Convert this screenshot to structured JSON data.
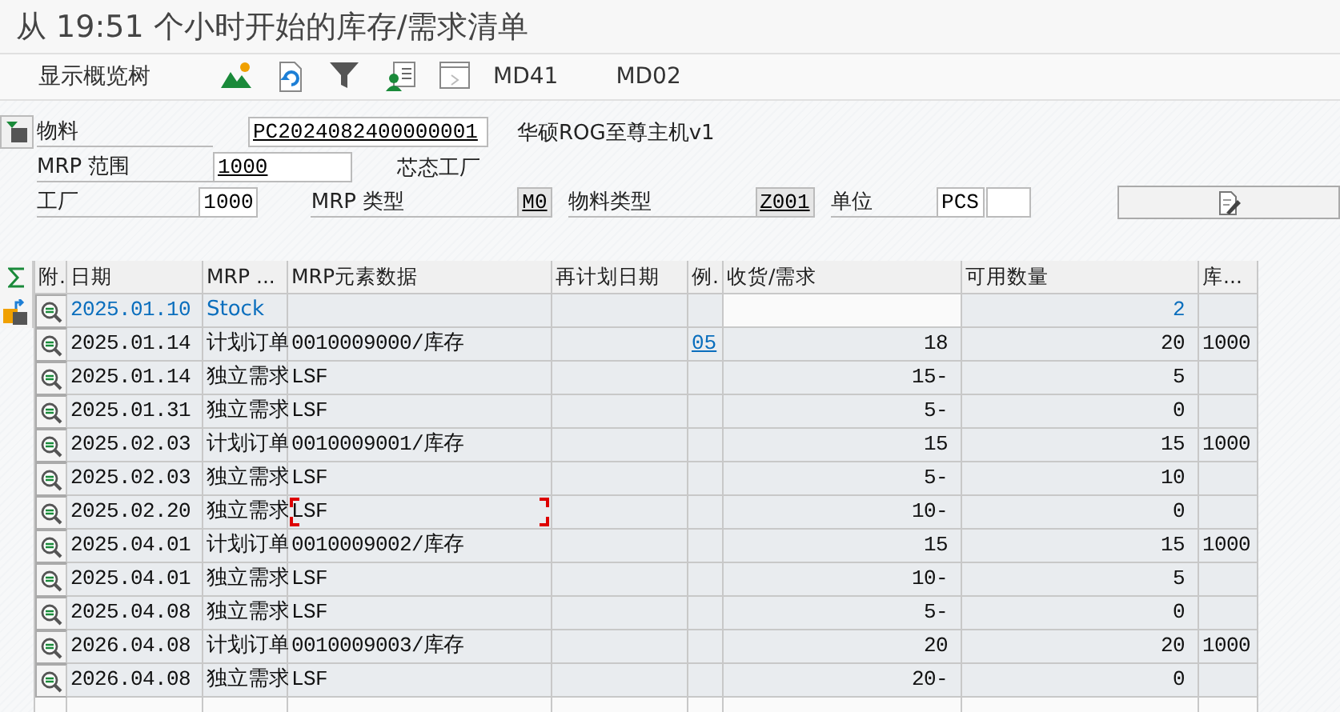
{
  "window": {
    "title": "从 19:51 个小时开始的库存/需求清单"
  },
  "toolbar": {
    "items": [
      {
        "kind": "text",
        "label": "显示概览树"
      },
      {
        "kind": "icon"
      },
      {
        "kind": "icon"
      },
      {
        "kind": "icon"
      },
      {
        "kind": "icon"
      },
      {
        "kind": "icon"
      },
      {
        "kind": "text",
        "label": "MD41"
      },
      {
        "kind": "text",
        "label": "MD02"
      }
    ]
  },
  "header": {
    "material_label": "物料",
    "material_value": "PC2024082400000001",
    "material_desc": "华硕ROG至尊主机v1",
    "mrp_area_label": "MRP 范围",
    "mrp_area_value": "1000",
    "mrp_area_desc": "芯态工厂",
    "plant_label": "工厂",
    "plant_value": "1000",
    "mrp_type_label": "MRP 类型",
    "mrp_type_value": "M0",
    "material_type_label": "物料类型",
    "material_type_value": "Z001",
    "unit_label": "单位",
    "unit_value": "PCS"
  },
  "table": {
    "columns": [
      "附.",
      "日期",
      "MRP ...",
      "MRP元素数据",
      "再计划日期",
      "例.",
      "收货/需求",
      "可用数量",
      "库..."
    ],
    "rows": [
      {
        "kind": "stock",
        "focused": false,
        "date": "2025.01.10",
        "element": "Stock",
        "data": "",
        "exception": "",
        "qty": "",
        "available": "2",
        "storage": ""
      },
      {
        "kind": "element",
        "focused": false,
        "date": "2025.01.14",
        "element": "计划订单",
        "data": "0010009000/库存",
        "exception": "05",
        "qty": "18",
        "available": "20",
        "storage": "1000"
      },
      {
        "kind": "element",
        "focused": false,
        "date": "2025.01.14",
        "element": "独立需求",
        "data": "LSF",
        "exception": "",
        "qty": "15-",
        "available": "5",
        "storage": ""
      },
      {
        "kind": "element",
        "focused": false,
        "date": "2025.01.31",
        "element": "独立需求",
        "data": "LSF",
        "exception": "",
        "qty": "5-",
        "available": "0",
        "storage": ""
      },
      {
        "kind": "element",
        "focused": false,
        "date": "2025.02.03",
        "element": "计划订单",
        "data": "0010009001/库存",
        "exception": "",
        "qty": "15",
        "available": "15",
        "storage": "1000"
      },
      {
        "kind": "element",
        "focused": false,
        "date": "2025.02.03",
        "element": "独立需求",
        "data": "LSF",
        "exception": "",
        "qty": "5-",
        "available": "10",
        "storage": ""
      },
      {
        "kind": "element",
        "focused": true,
        "date": "2025.02.20",
        "element": "独立需求",
        "data": "LSF",
        "exception": "",
        "qty": "10-",
        "available": "0",
        "storage": ""
      },
      {
        "kind": "element",
        "focused": false,
        "date": "2025.04.01",
        "element": "计划订单",
        "data": "0010009002/库存",
        "exception": "",
        "qty": "15",
        "available": "15",
        "storage": "1000"
      },
      {
        "kind": "element",
        "focused": false,
        "date": "2025.04.01",
        "element": "独立需求",
        "data": "LSF",
        "exception": "",
        "qty": "10-",
        "available": "5",
        "storage": ""
      },
      {
        "kind": "element",
        "focused": false,
        "date": "2025.04.08",
        "element": "独立需求",
        "data": "LSF",
        "exception": "",
        "qty": "5-",
        "available": "0",
        "storage": ""
      },
      {
        "kind": "element",
        "focused": false,
        "date": "2026.04.08",
        "element": "计划订单",
        "data": "0010009003/库存",
        "exception": "",
        "qty": "20",
        "available": "20",
        "storage": "1000"
      },
      {
        "kind": "element",
        "focused": false,
        "date": "2026.04.08",
        "element": "独立需求",
        "data": "LSF",
        "exception": "",
        "qty": "20-",
        "available": "0",
        "storage": ""
      }
    ]
  }
}
